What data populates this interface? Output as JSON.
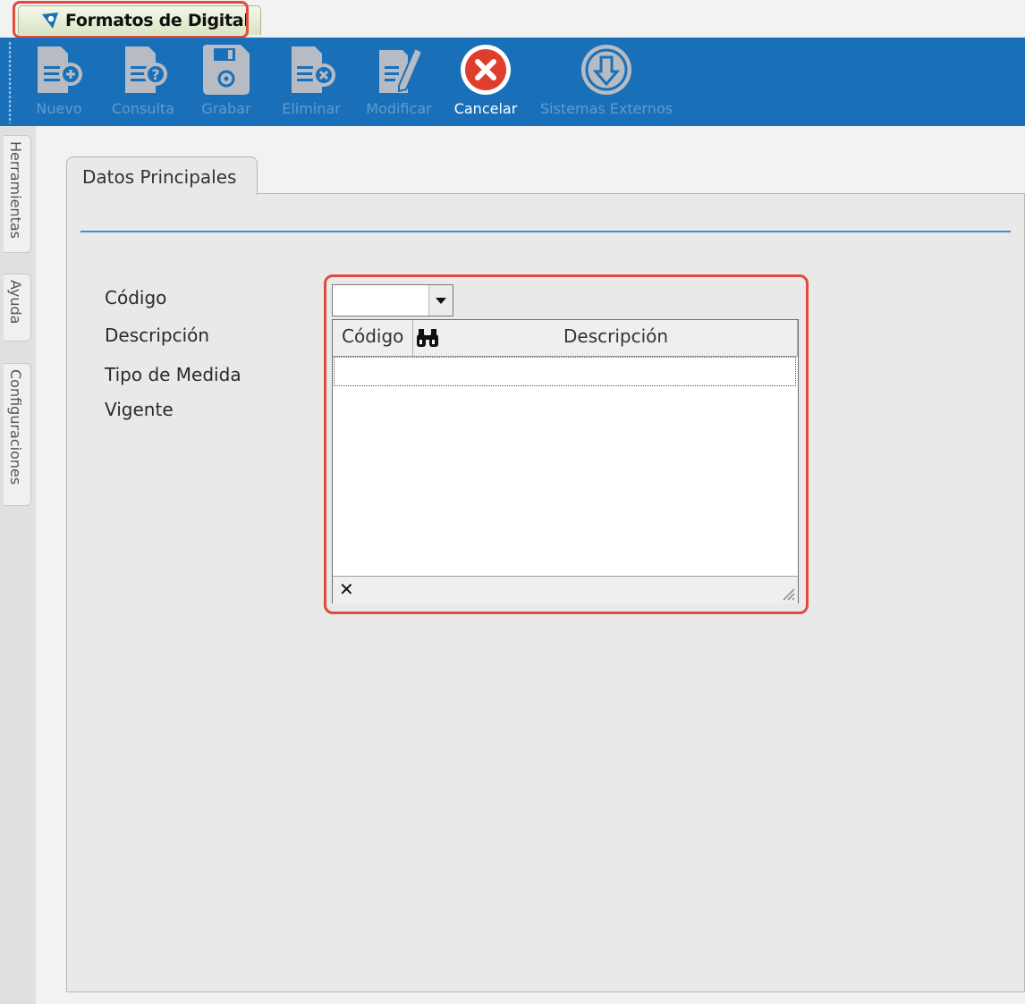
{
  "window_tab": {
    "title": "Formatos de Digital"
  },
  "toolbar": {
    "buttons": [
      {
        "id": "nuevo",
        "label": "Nuevo",
        "icon": "new-document-icon",
        "enabled": false
      },
      {
        "id": "consulta",
        "label": "Consulta",
        "icon": "query-document-icon",
        "enabled": false
      },
      {
        "id": "grabar",
        "label": "Grabar",
        "icon": "save-disk-icon",
        "enabled": false
      },
      {
        "id": "eliminar",
        "label": "Eliminar",
        "icon": "delete-document-icon",
        "enabled": false
      },
      {
        "id": "modificar",
        "label": "Modificar",
        "icon": "edit-pencil-icon",
        "enabled": false
      },
      {
        "id": "cancelar",
        "label": "Cancelar",
        "icon": "cancel-x-icon",
        "enabled": true
      },
      {
        "id": "sistemas",
        "label": "Sistemas Externos",
        "icon": "external-systems-icon",
        "enabled": false
      }
    ]
  },
  "side_tabs": [
    "Herramientas",
    "Ayuda",
    "Configuraciones"
  ],
  "main": {
    "tab_label": "Datos Principales",
    "fields": [
      "Código",
      "Descripción",
      "Tipo de Medida",
      "Vigente"
    ]
  },
  "dropdown": {
    "columns": [
      "Código",
      "Descripción"
    ],
    "search_icon": "binoculars-icon",
    "close_glyph": "✕"
  },
  "colors": {
    "toolbar": "#1a70b8",
    "highlight": "#e04b3c",
    "separator": "#3f8ed0"
  }
}
